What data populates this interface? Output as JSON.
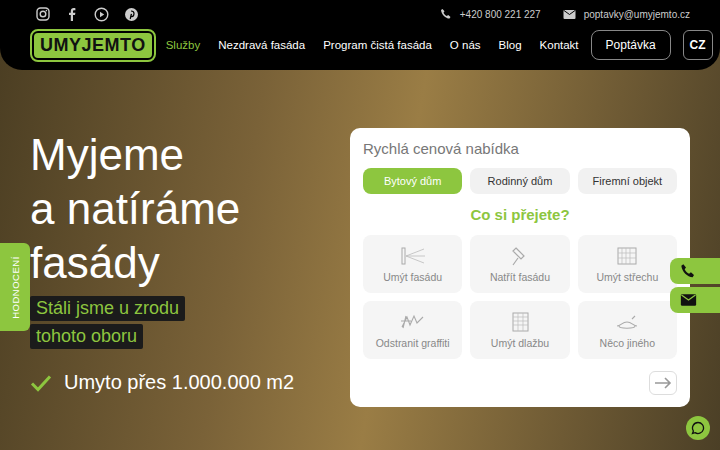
{
  "contact": {
    "phone": "+420 800 221 227",
    "email": "poptavky@umyjemto.cz"
  },
  "logo": "UMYJEMTO",
  "nav": [
    {
      "label": "Služby",
      "selected": true
    },
    {
      "label": "Nezdravá fasáda",
      "selected": false
    },
    {
      "label": "Program čistá fasáda",
      "selected": false
    },
    {
      "label": "O nás",
      "selected": false
    },
    {
      "label": "Blog",
      "selected": false
    },
    {
      "label": "Kontakt",
      "selected": false
    }
  ],
  "cta_button": "Poptávka",
  "language": "CZ",
  "hero": {
    "title_lines": [
      "Myjeme",
      "a natíráme",
      "fasády"
    ],
    "tags": [
      "Stáli jsme u zrodu",
      "tohoto oboru"
    ],
    "highlight": "Umyto přes 1.000.000 m2"
  },
  "side_tab": "HODNOCENÍ",
  "quote_card": {
    "title": "Rychlá cenová nabídka",
    "tabs": [
      {
        "label": "Bytový dům",
        "selected": true
      },
      {
        "label": "Rodinný dům",
        "selected": false
      },
      {
        "label": "Firemní objekt",
        "selected": false
      }
    ],
    "question": "Co si přejete?",
    "options": [
      {
        "label": "Umýt fasádu"
      },
      {
        "label": "Natřít fasádu"
      },
      {
        "label": "Umýt střechu"
      },
      {
        "label": "Odstranit graffiti"
      },
      {
        "label": "Umýt dlažbu"
      },
      {
        "label": "Něco jiného"
      }
    ]
  }
}
